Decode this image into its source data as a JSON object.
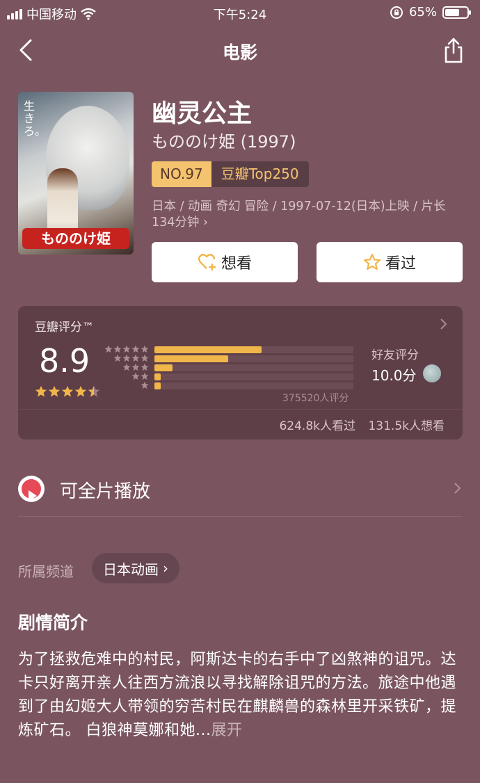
{
  "status": {
    "carrier": "中国移动",
    "time": "下午5:24",
    "battery": "65%",
    "battery_level": 0.65
  },
  "nav": {
    "title": "电影"
  },
  "movie": {
    "title": "幽灵公主",
    "original": "もののけ姫 (1997)",
    "rank_no": "NO.97",
    "rank_list": "豆瓣Top250",
    "meta_line1": "日本 / 动画 奇幻 冒险 / 1997-07-12(日本)上映 / 片长",
    "meta_line2": "134分钟",
    "poster_title": "もののけ姫",
    "poster_tag": "生きろ。"
  },
  "actions": {
    "want": "想看",
    "seen": "看过"
  },
  "rating": {
    "label": "豆瓣评分™",
    "score": "8.9",
    "stars": 4.5,
    "distribution": [
      {
        "stars": 5,
        "fraction": 0.54
      },
      {
        "stars": 4,
        "fraction": 0.37
      },
      {
        "stars": 3,
        "fraction": 0.09
      },
      {
        "stars": 2,
        "fraction": 0.03
      },
      {
        "stars": 1,
        "fraction": 0.03
      }
    ],
    "count": "375520人评分",
    "friend_label": "好友评分",
    "friend_score": "10.0分",
    "watched": "624.8k人看过",
    "wants": "131.5k人想看"
  },
  "play": {
    "label": "可全片播放"
  },
  "channel": {
    "label": "所属频道",
    "tag": "日本动画"
  },
  "synopsis": {
    "title": "剧情简介",
    "text": "为了拯救危难中的村民，阿斯达卡的右手中了凶煞神的诅咒。达卡只好离开亲人往西方流浪以寻找解除诅咒的方法。旅途中他遇到了由幻姬大人带领的穷苦村民在麒麟兽的森林里开采铁矿，提炼矿石。 白狼神莫娜和她...",
    "more": "展开"
  },
  "colors": {
    "background": "#7a5560",
    "accent_gold": "#f1b64a",
    "play_red": "#e64a57"
  }
}
